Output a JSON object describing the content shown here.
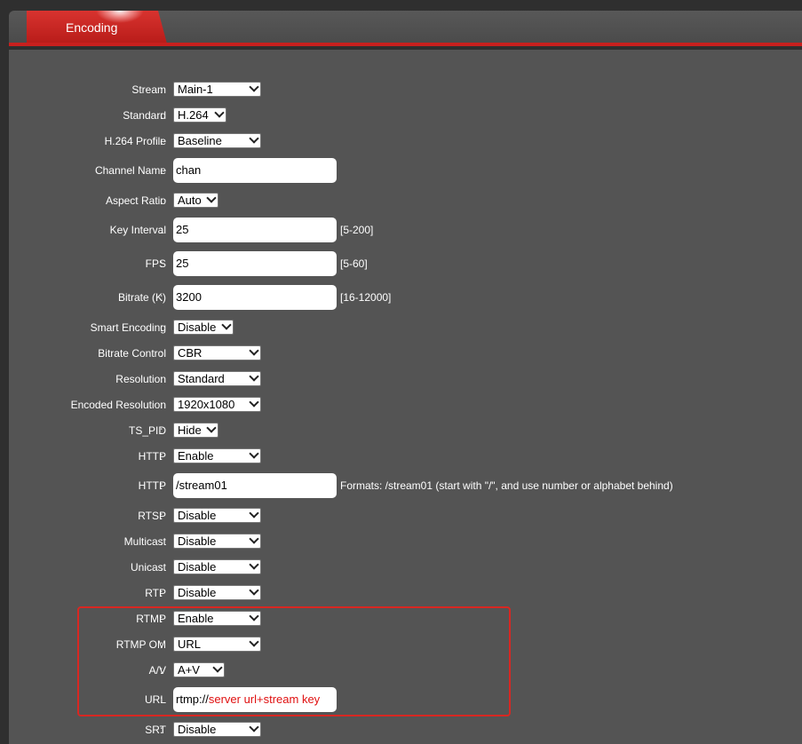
{
  "tab": {
    "label": "Encoding"
  },
  "form": {
    "stream": {
      "label": "Stream",
      "value": "Main-1"
    },
    "standard": {
      "label": "Standard",
      "value": "H.264"
    },
    "profile": {
      "label": "H.264 Profile",
      "value": "Baseline"
    },
    "channel_name": {
      "label": "Channel Name",
      "value": "chan"
    },
    "aspect_ratio": {
      "label": "Aspect Ratio",
      "value": "Auto"
    },
    "key_interval": {
      "label": "Key Interval",
      "value": "25",
      "hint": "[5-200]"
    },
    "fps": {
      "label": "FPS",
      "value": "25",
      "hint": "[5-60]"
    },
    "bitrate": {
      "label": "Bitrate (K)",
      "value": "3200",
      "hint": "[16-12000]"
    },
    "smart_encoding": {
      "label": "Smart Encoding",
      "value": "Disable"
    },
    "bitrate_control": {
      "label": "Bitrate Control",
      "value": "CBR"
    },
    "resolution": {
      "label": "Resolution",
      "value": "Standard"
    },
    "encoded_resolution": {
      "label": "Encoded Resolution",
      "value": "1920x1080"
    },
    "ts_pid": {
      "label": "TS_PID",
      "value": "Hide"
    },
    "http_toggle": {
      "label": "HTTP",
      "value": "Enable"
    },
    "http_path": {
      "label": "HTTP",
      "value": "/stream01",
      "hint": "Formats: /stream01 (start with \"/\", and use number or alphabet behind)"
    },
    "rtsp": {
      "label": "RTSP",
      "value": "Disable"
    },
    "multicast": {
      "label": "Multicast",
      "value": "Disable"
    },
    "unicast": {
      "label": "Unicast",
      "value": "Disable"
    },
    "rtp": {
      "label": "RTP",
      "value": "Disable"
    },
    "rtmp": {
      "label": "RTMP",
      "value": "Enable"
    },
    "rtmp_om": {
      "label": "RTMP OM",
      "value": "URL"
    },
    "av": {
      "label": "A/V",
      "value": "A+V"
    },
    "url": {
      "label": "URL",
      "prefix": "rtmp://",
      "annotation": "server url+stream key"
    },
    "srt": {
      "label": "SRT",
      "value": "Disable"
    }
  },
  "colon": ":",
  "colors": {
    "accent": "#c8201e",
    "panel": "#545454",
    "highlight": "#d82722"
  }
}
